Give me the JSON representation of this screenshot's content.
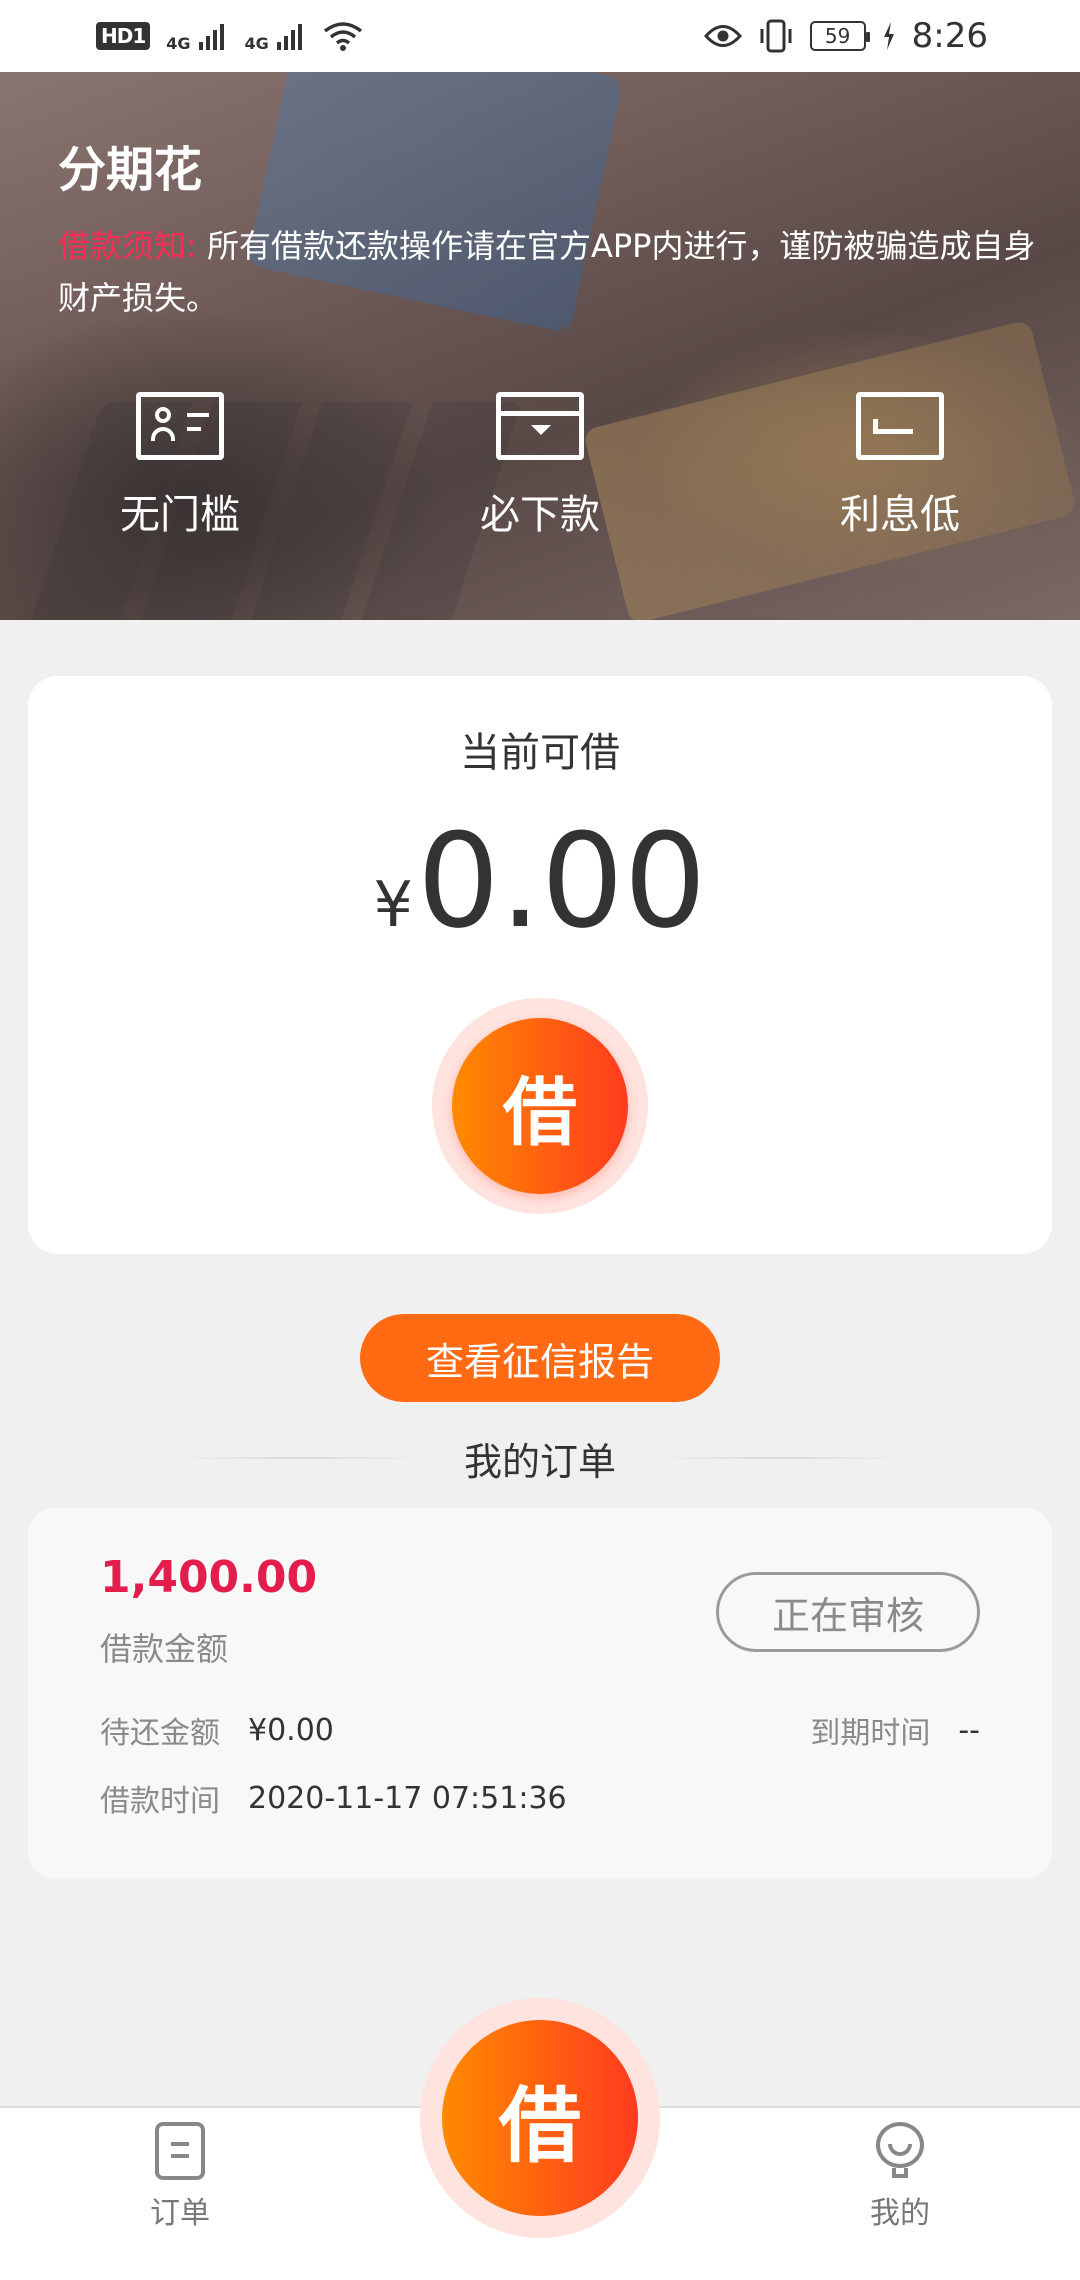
{
  "status_bar": {
    "hd": "HD",
    "hd_sub": "1",
    "net1": "4G",
    "net2": "4G",
    "battery": "59",
    "time": "8:26"
  },
  "banner": {
    "title": "分期花",
    "notice_label": "借款须知:",
    "notice_text": "所有借款还款操作请在官方APP内进行，谨防被骗造成自身财产损失。",
    "features": [
      {
        "label": "无门槛",
        "icon": "id-card-icon"
      },
      {
        "label": "必下款",
        "icon": "wallet-icon"
      },
      {
        "label": "利息低",
        "icon": "card-icon"
      }
    ]
  },
  "credit": {
    "label": "当前可借",
    "currency": "¥",
    "amount": "0.00",
    "borrow_button": "借"
  },
  "report_button": "查看征信报告",
  "orders": {
    "title": "我的订单",
    "items": [
      {
        "amount": "1,400.00",
        "amount_label": "借款金额",
        "status": "正在审核",
        "pending_label": "待还金额",
        "pending_value": "¥0.00",
        "due_label": "到期时间",
        "due_value": "--",
        "time_label": "借款时间",
        "time_value": "2020-11-17 07:51:36"
      }
    ]
  },
  "bottom_nav": {
    "orders": "订单",
    "borrow": "借",
    "mine": "我的"
  },
  "colors": {
    "accent": "#ff6a13",
    "notice": "#ff2d55",
    "amount": "#e31e4c"
  }
}
